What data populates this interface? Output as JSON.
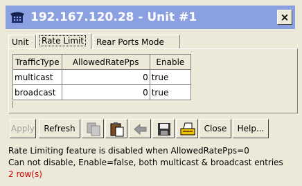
{
  "window": {
    "title": "192.167.120.28 - Unit #1",
    "close_glyph": "×"
  },
  "tabs": [
    {
      "label": "Unit"
    },
    {
      "label": "Rate Limit",
      "active": true
    },
    {
      "label": "Rear Ports Mode"
    }
  ],
  "table": {
    "columns": [
      "TrafficType",
      "AllowedRatePps",
      "Enable"
    ],
    "rows": [
      [
        "multicast",
        "0",
        "true"
      ],
      [
        "broadcast",
        "0",
        "true"
      ]
    ]
  },
  "toolbar": {
    "apply": "Apply",
    "refresh": "Refresh",
    "close": "Close",
    "help": "Help...",
    "icons": [
      "copy-icon",
      "paste-icon",
      "undo-icon",
      "save-icon",
      "print-icon"
    ]
  },
  "status": {
    "line1": "Rate Limiting feature is disabled when AllowedRatePps=0",
    "line2": "Can not disable, Enable=false, both multicast & broadcast entries",
    "row_count": "2 row(s)",
    "row_count_color": "#cc0000"
  },
  "colors": {
    "titlebar": "#8aa0e0",
    "window": "#ece9d8"
  }
}
